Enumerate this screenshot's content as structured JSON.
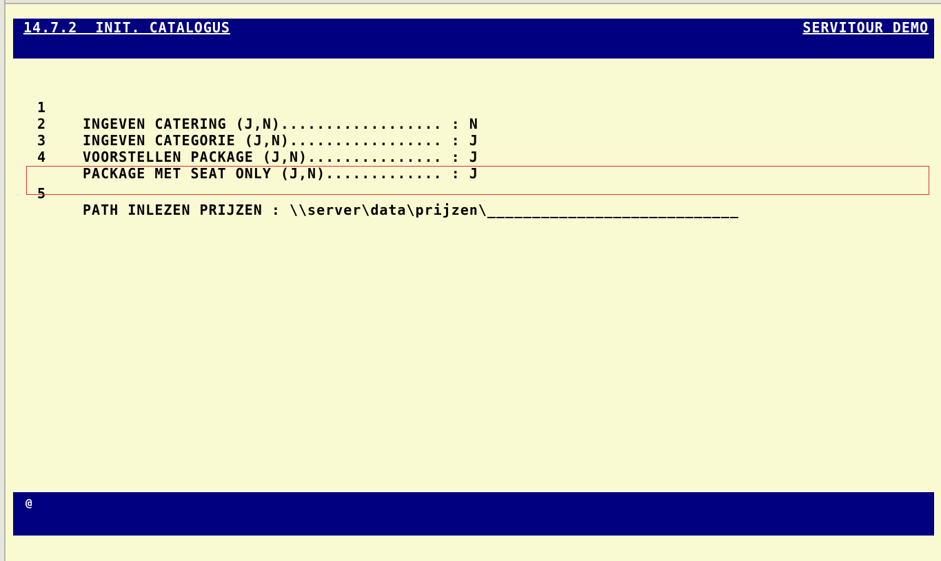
{
  "header": {
    "screen_title": "14.7.2  INIT. CATALOGUS",
    "company": "SERVITOUR DEMO"
  },
  "menu": {
    "items": [
      {
        "number": "1",
        "label": "INGEVEN CATERING (J,N).................. : N"
      },
      {
        "number": "2",
        "label": "INGEVEN CATEGORIE (J,N)................. : J"
      },
      {
        "number": "3",
        "label": "VOORSTELLEN PACKAGE (J,N)............... : J"
      },
      {
        "number": "4",
        "label": "PACKAGE MET SEAT ONLY (J,N)............. : J"
      },
      {
        "number": "5",
        "label": "PATH INLEZEN PRIJZEN : \\\\server\\data\\prijzen\\____________________________"
      }
    ],
    "selected_index": 5
  },
  "status": {
    "prompt": "@"
  },
  "colors": {
    "background": "#fafad2",
    "bar": "#000080",
    "highlight_border": "#e03030"
  }
}
